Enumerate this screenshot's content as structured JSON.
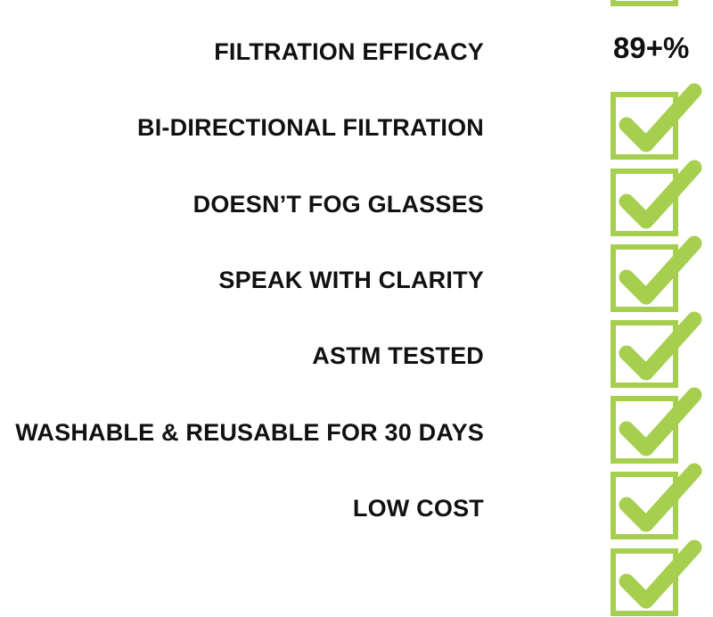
{
  "colors": {
    "check_green": "#a6cf4f",
    "text": "#111111"
  },
  "icons": {
    "check": "checkbox-check-icon"
  },
  "features": [
    {
      "label": "FILTRATION EFFICACY",
      "value": "89+%"
    },
    {
      "label": "BI-DIRECTIONAL FILTRATION",
      "status": "checked"
    },
    {
      "label": "DOESN’T FOG GLASSES",
      "status": "checked"
    },
    {
      "label": "SPEAK WITH CLARITY",
      "status": "checked"
    },
    {
      "label": "ASTM TESTED",
      "status": "checked"
    },
    {
      "label": "WASHABLE & REUSABLE FOR 30 DAYS",
      "status": "checked"
    },
    {
      "label": "LOW COST",
      "status": "checked"
    }
  ]
}
